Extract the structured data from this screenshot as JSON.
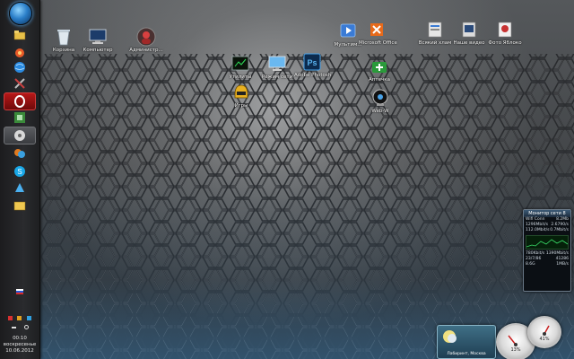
{
  "desktop_icons": [
    {
      "id": "recycle",
      "label": "Корзина",
      "icon": "recycle-bin-icon"
    },
    {
      "id": "computer",
      "label": "Компьютер",
      "icon": "computer-icon"
    },
    {
      "id": "admin",
      "label": "Администр...",
      "icon": "user-folder-icon"
    },
    {
      "id": "multimedia",
      "label": "Мультим...",
      "icon": "multimedia-icon"
    },
    {
      "id": "office",
      "label": "Microsoft Office",
      "icon": "office-icon"
    },
    {
      "id": "allbank",
      "label": "Всякий хлам",
      "icon": "folder-icon"
    },
    {
      "id": "video",
      "label": "Наше видео",
      "icon": "video-folder-icon"
    },
    {
      "id": "photo",
      "label": "Фото Яблоко",
      "icon": "photo-folder-icon"
    },
    {
      "id": "cmd",
      "label": "Утилиты",
      "icon": "terminal-icon"
    },
    {
      "id": "display",
      "label": "Режим сети",
      "icon": "monitor-icon"
    },
    {
      "id": "photoshop",
      "label": "Adobe Photosh",
      "icon": "photoshop-icon"
    },
    {
      "id": "aptechka",
      "label": "Аптечка",
      "icon": "medkit-icon"
    },
    {
      "id": "games",
      "label": "Игры",
      "icon": "helmet-icon"
    },
    {
      "id": "webcam",
      "label": "Web-W",
      "icon": "webcam-icon"
    }
  ],
  "taskbar": {
    "start_icon": "windows-orb-icon",
    "buttons": [
      {
        "icon": "folder-icon"
      },
      {
        "icon": "media-icon"
      },
      {
        "icon": "globe-icon"
      },
      {
        "icon": "tools-icon"
      },
      {
        "icon": "opera-icon"
      },
      {
        "icon": "shield-icon"
      },
      {
        "icon": "disk-icon"
      },
      {
        "icon": "messenger-icon"
      },
      {
        "icon": "skype-icon"
      },
      {
        "icon": "network-icon"
      },
      {
        "icon": "explorer-icon"
      }
    ],
    "clock": {
      "time": "00:10",
      "day": "воскресенье",
      "date": "10.06.2012"
    }
  },
  "monitor_gadget": {
    "title": "Монитор сети 8",
    "rows": [
      [
        "Wifi Conn",
        "8.2Mb"
      ],
      [
        "1296Mbit/s",
        "2.6790/s"
      ],
      [
        "112.0Mbit/s",
        "0.7Mbit/s"
      ]
    ],
    "rows2": [
      [
        "780Kbit/s",
        "1390Mbit/s"
      ],
      [
        "23/7/86",
        "41286"
      ],
      [
        "8.6G",
        "1MB/s"
      ]
    ]
  },
  "weather_gadget": {
    "text": "Лабиринт, Москва"
  },
  "gauges": {
    "cpu": "13%",
    "ram": "41%"
  },
  "colors": {
    "taskbar": "#222325",
    "hex_edge": "#5aa9e6"
  }
}
